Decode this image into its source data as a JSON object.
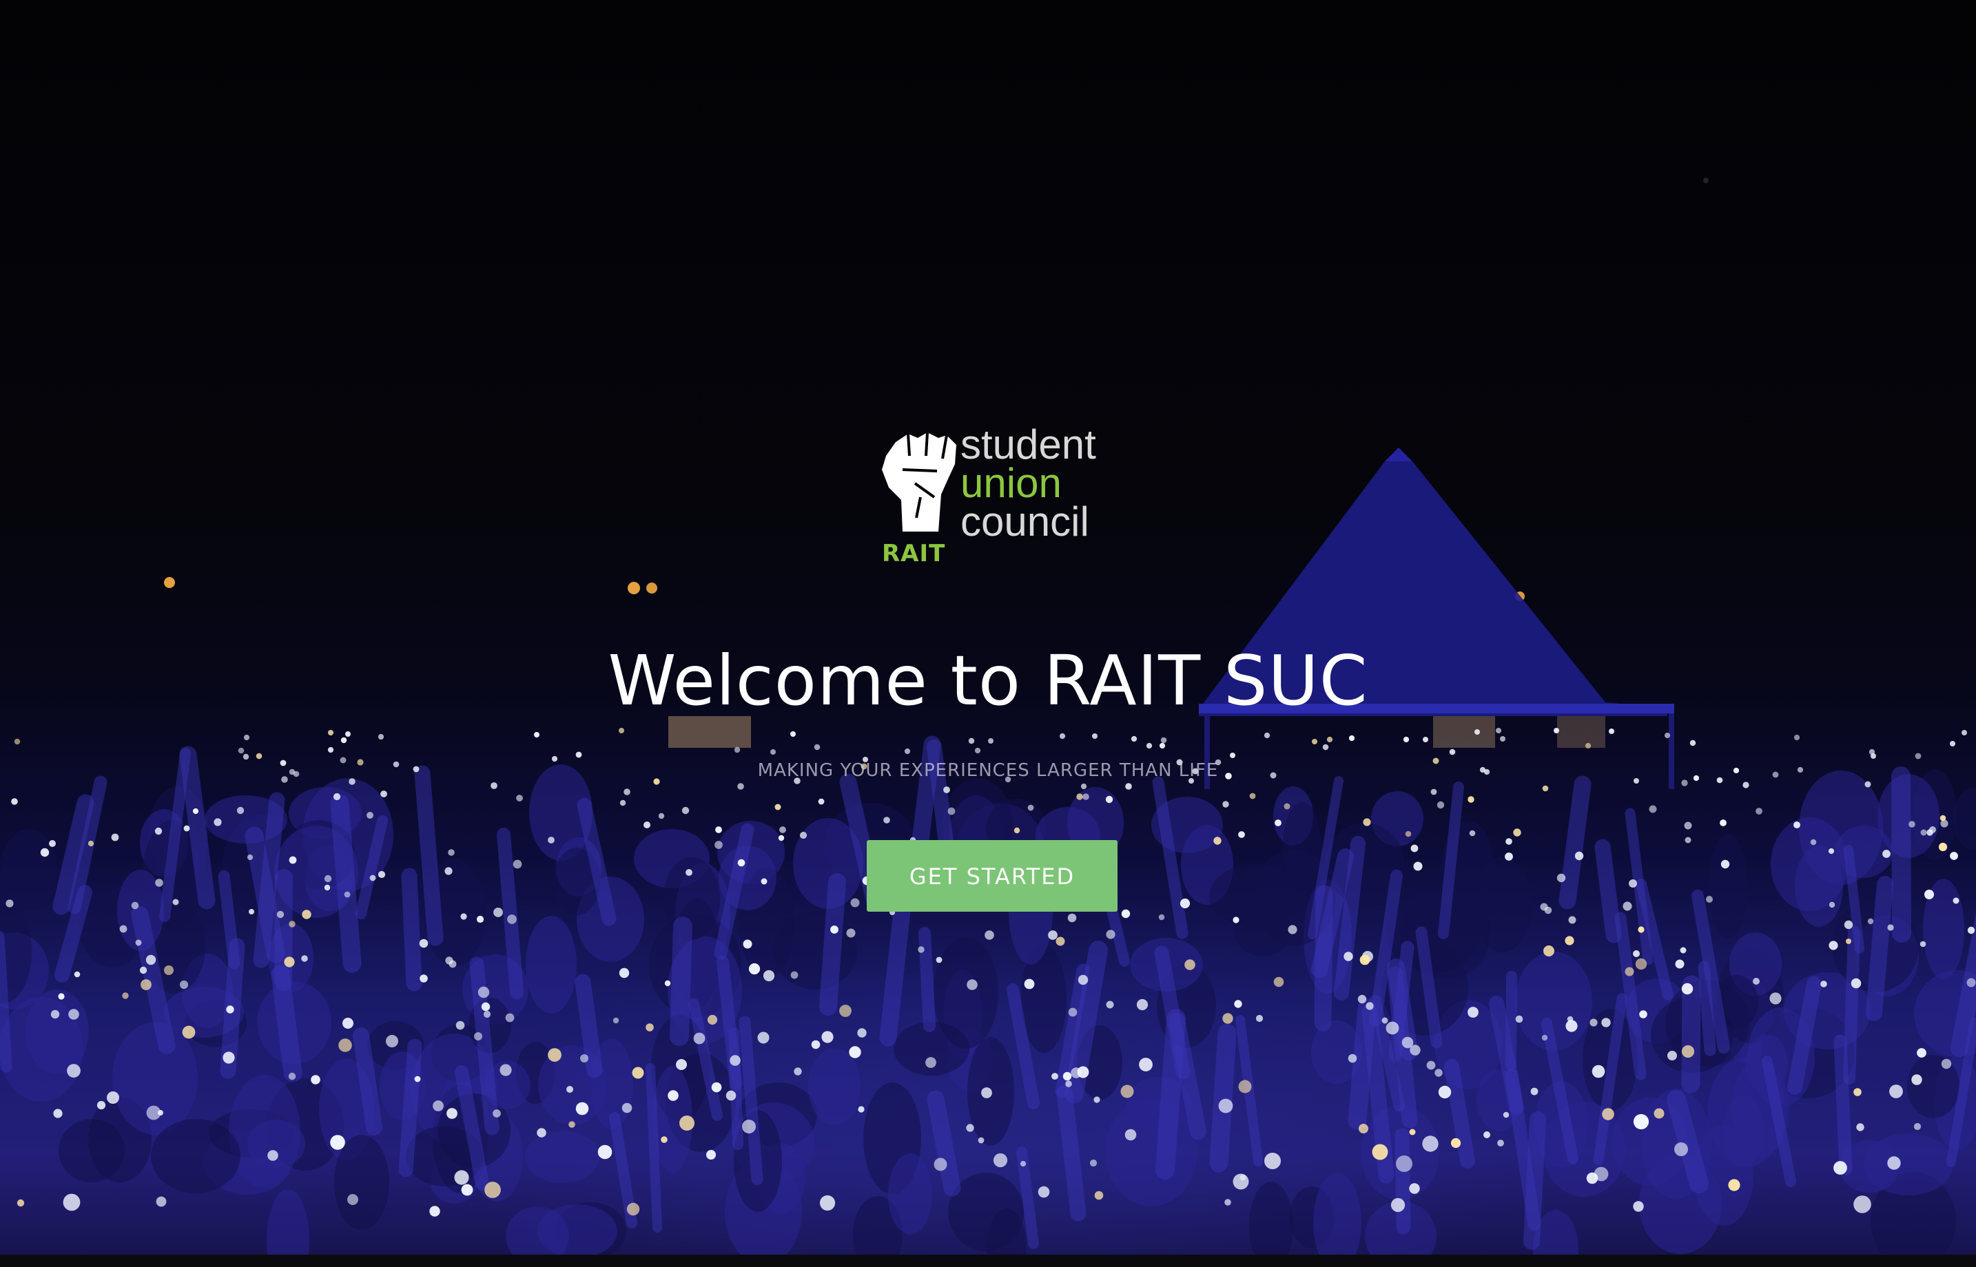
{
  "hero": {
    "background_image": "concert-crowd-phone-lights",
    "title": "Welcome to RAIT SUC",
    "subtitle": "MAKING YOUR EXPERIENCES LARGER THAN LIFE",
    "cta_label": "GET STARTED"
  },
  "logo": {
    "icon": "raised-fist-icon",
    "word1": "student",
    "word2": "union",
    "word3": "council",
    "acronym": "RAIT"
  },
  "colors": {
    "accent_green": "#7cc576",
    "logo_green": "#8cc63f",
    "title_white": "#ffffff"
  }
}
